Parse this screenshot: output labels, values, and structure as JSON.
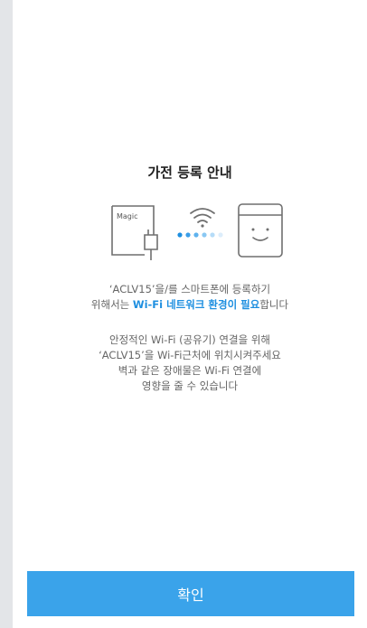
{
  "dialog": {
    "title": "가전 등록 안내",
    "illustration": {
      "plug_label": "Magic",
      "icons": [
        "plug-icon",
        "wifi-icon",
        "connecting-dots-icon",
        "appliance-icon"
      ]
    },
    "message1": {
      "line1": "‘ACLV15’을/를 스마트폰에 등록하기",
      "line2_pre": "위해서는 ",
      "line2_highlight": "Wi-Fi 네트워크 환경이 필요",
      "line2_post": "합니다"
    },
    "message2": {
      "lines": [
        "안정적인 Wi-Fi (공유기) 연결을 위해",
        "‘ACLV15’을 Wi-Fi근처에 위치시켜주세요",
        "벽과 같은 장애물은 Wi-Fi 연결에",
        "영향을 줄 수 있습니다"
      ]
    },
    "confirm_label": "확인"
  },
  "colors": {
    "accent": "#1e8fe0",
    "button": "#3aa3ea",
    "icon_stroke": "#6f6f6f"
  }
}
